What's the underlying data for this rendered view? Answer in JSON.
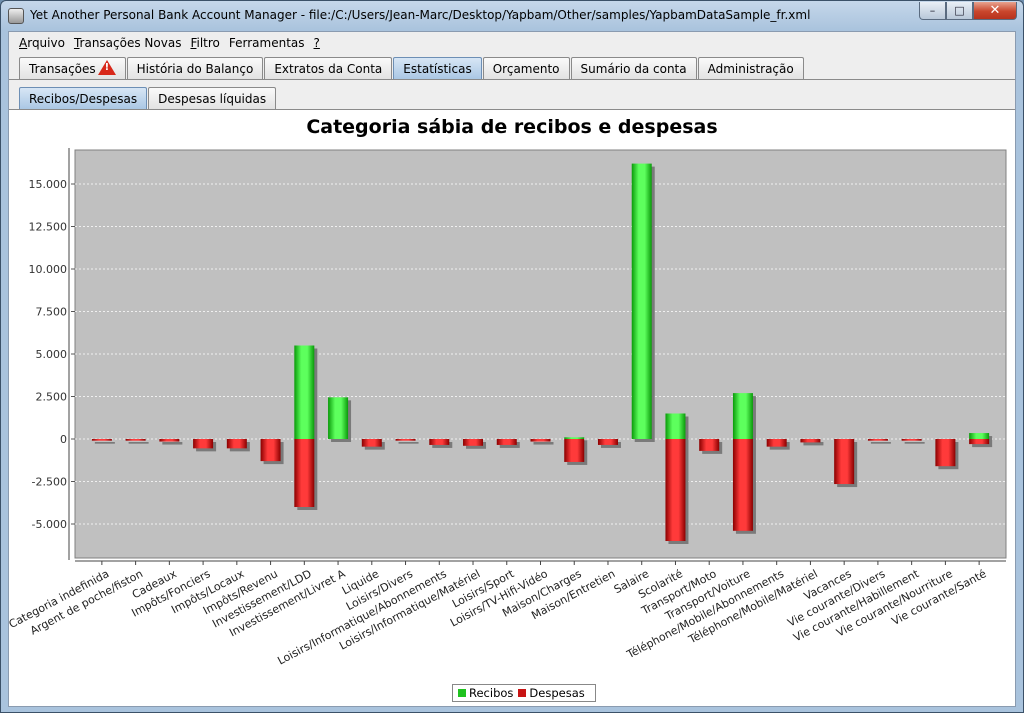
{
  "window": {
    "title": "Yet Another Personal Bank Account Manager - file:/C:/Users/Jean-Marc/Desktop/Yapbam/Other/samples/YapbamDataSample_fr.xml",
    "minimize_label": "–",
    "maximize_label": "□",
    "close_label": "✕"
  },
  "menu": [
    {
      "underline": "A",
      "rest": "rquivo"
    },
    {
      "underline": "T",
      "rest": "ransações Novas"
    },
    {
      "underline": "F",
      "rest": "iltro"
    },
    {
      "underline": "",
      "rest": "Ferramentas"
    },
    {
      "underline": "?",
      "rest": ""
    }
  ],
  "main_tabs": [
    {
      "label": "Transações",
      "warning": true
    },
    {
      "label": "História do Balanço"
    },
    {
      "label": "Extratos da Conta"
    },
    {
      "label": "Estatísticas",
      "selected": true
    },
    {
      "label": "Orçamento"
    },
    {
      "label": "Sumário da conta"
    },
    {
      "label": "Administração"
    }
  ],
  "sub_tabs": [
    {
      "label": "Recibos/Despesas",
      "selected": true
    },
    {
      "label": "Despesas líquidas"
    }
  ],
  "colors": {
    "receipts": "#1fc21f",
    "expenses": "#c81414",
    "plot_bg": "#c0c0c0",
    "selected_tab": "#aac7e4"
  },
  "chart_data": {
    "type": "bar",
    "title": "Categoria sábia de recibos e despesas",
    "ylim": [
      -7000,
      17000
    ],
    "yticks": [
      -5000,
      -2500,
      0,
      2500,
      5000,
      7500,
      10000,
      12500,
      15000
    ],
    "ytick_labels": [
      "-5.000",
      "-2.500",
      "0",
      "2.500",
      "5.000",
      "7.500",
      "10.000",
      "12.500",
      "15.000"
    ],
    "grid": true,
    "legend_position": "bottom",
    "categories": [
      "Categoria indefinida",
      "Argent de poche/fiston",
      "Cadeaux",
      "Impôts/Fonciers",
      "Impôts/Locaux",
      "Impôts/Revenu",
      "Investissement/LDD",
      "Investissement/Livret A",
      "Liquide",
      "Loisirs/Divers",
      "Loisirs/Informatique/Abonnements",
      "Loisirs/Informatique/Matériel",
      "Loisirs/Sport",
      "Loisirs/TV-Hifi-Vidéo",
      "Maison/Charges",
      "Maison/Entretien",
      "Salaire",
      "Scolarité",
      "Transport/Moto",
      "Transport/Voiture",
      "Téléphone/Mobile/Abonnements",
      "Téléphone/Mobile/Matériel",
      "Vacances",
      "Vie courante/Divers",
      "Vie courante/Habillement",
      "Vie courante/Nourriture",
      "Vie courante/Santé"
    ],
    "series": [
      {
        "name": "Recibos",
        "values": [
          0,
          0,
          0,
          0,
          0,
          0,
          5500,
          2450,
          0,
          0,
          0,
          0,
          0,
          0,
          100,
          0,
          16200,
          1500,
          0,
          2700,
          0,
          0,
          0,
          0,
          0,
          0,
          350
        ]
      },
      {
        "name": "Despesas",
        "values": [
          -100,
          -100,
          -150,
          -550,
          -550,
          -1300,
          -4000,
          0,
          -450,
          -100,
          -350,
          -400,
          -350,
          -150,
          -1350,
          -350,
          0,
          -6000,
          -700,
          -5400,
          -450,
          -200,
          -2650,
          -100,
          -100,
          -1600,
          -300
        ]
      }
    ]
  }
}
